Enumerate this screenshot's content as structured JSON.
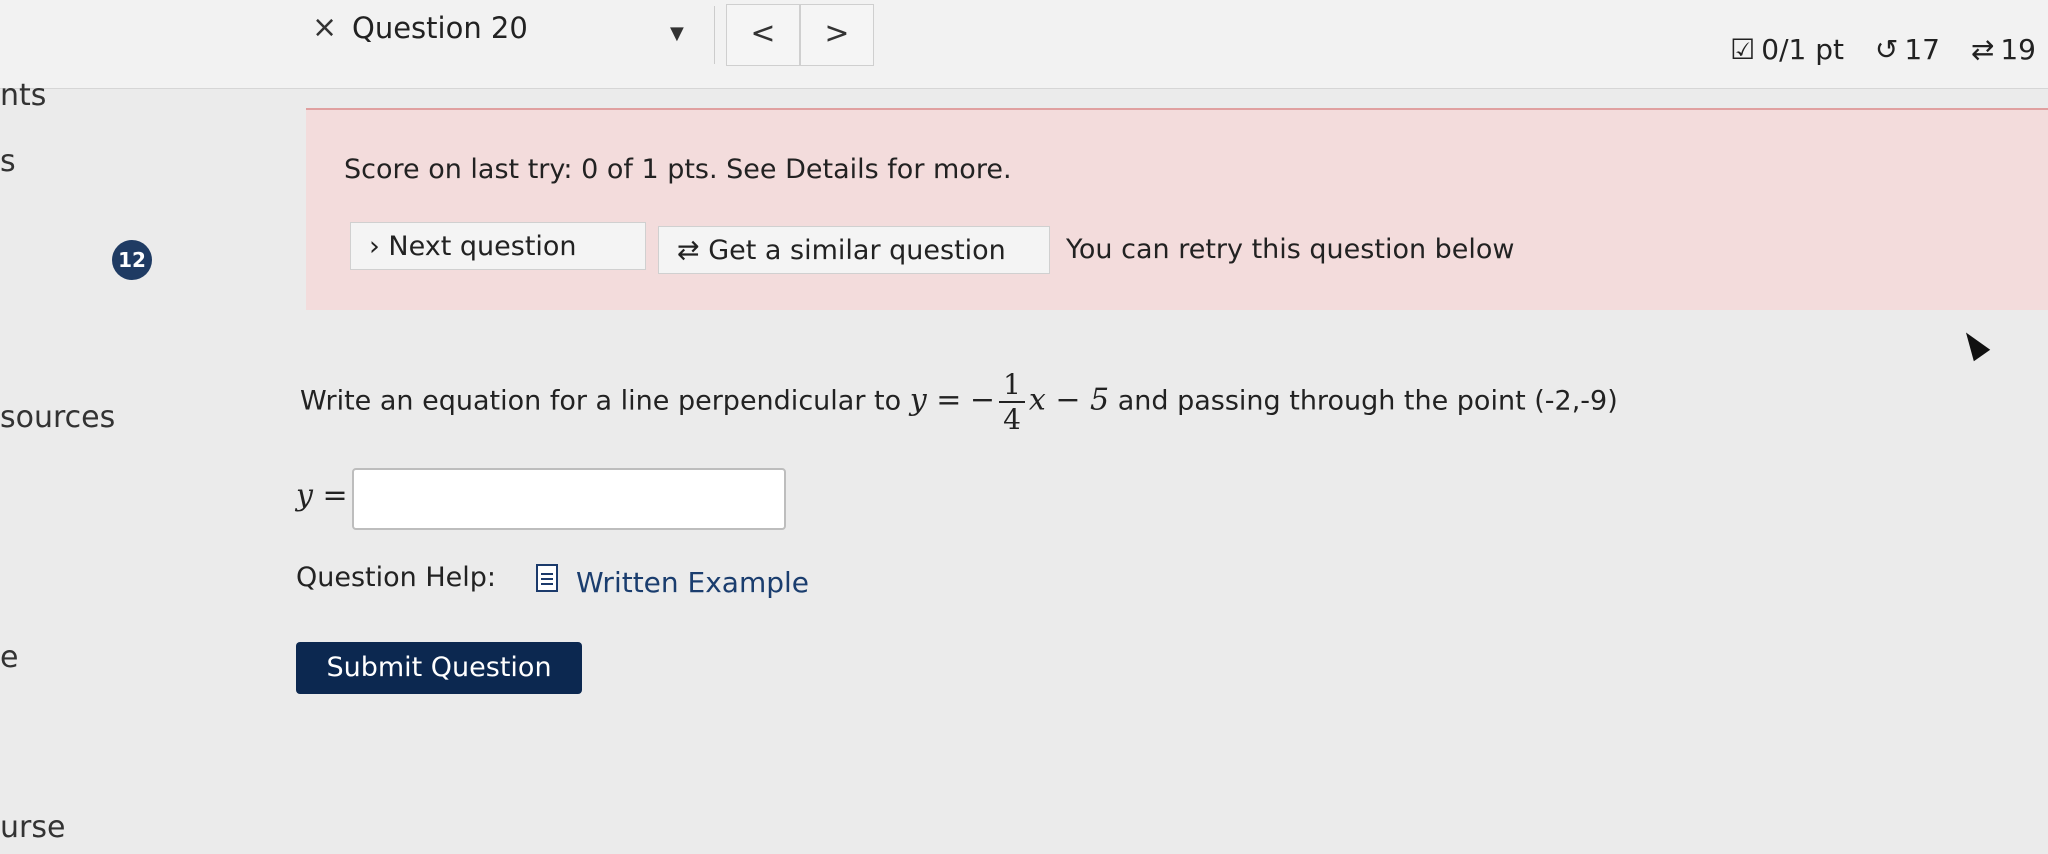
{
  "header": {
    "close_icon": "×",
    "question_title": "Question 20",
    "dropdown_caret": "▼",
    "prev_label": "<",
    "next_label": ">",
    "points": "0/1 pt",
    "retries": "17",
    "attempts": "19",
    "points_icon": "checkbox-icon",
    "retries_icon": "undo-icon",
    "attempts_icon": "repeat-icon"
  },
  "left_nav": {
    "item1": "nts",
    "item2": "s",
    "item3": "sources",
    "item4": "/",
    "item5": "e",
    "item6": "urse",
    "badge": "12"
  },
  "feedback": {
    "score_text": "Score on last try: 0 of 1 pts. See Details for more.",
    "next_question_label": "Next question",
    "similar_question_label": "Get a similar question",
    "retry_text": "You can retry this question below"
  },
  "question": {
    "prompt_prefix": "Write an equation for a line perpendicular to",
    "equation_lhs": "y =",
    "equation_sign": "−",
    "fraction_num": "1",
    "fraction_den": "4",
    "equation_rest": "x − 5",
    "prompt_suffix": "and passing through the point",
    "point": "(-2,-9)",
    "answer_label": "y =",
    "answer_value": ""
  },
  "help": {
    "label": "Question Help:",
    "link": "Written Example"
  },
  "submit": {
    "label": "Submit Question"
  }
}
